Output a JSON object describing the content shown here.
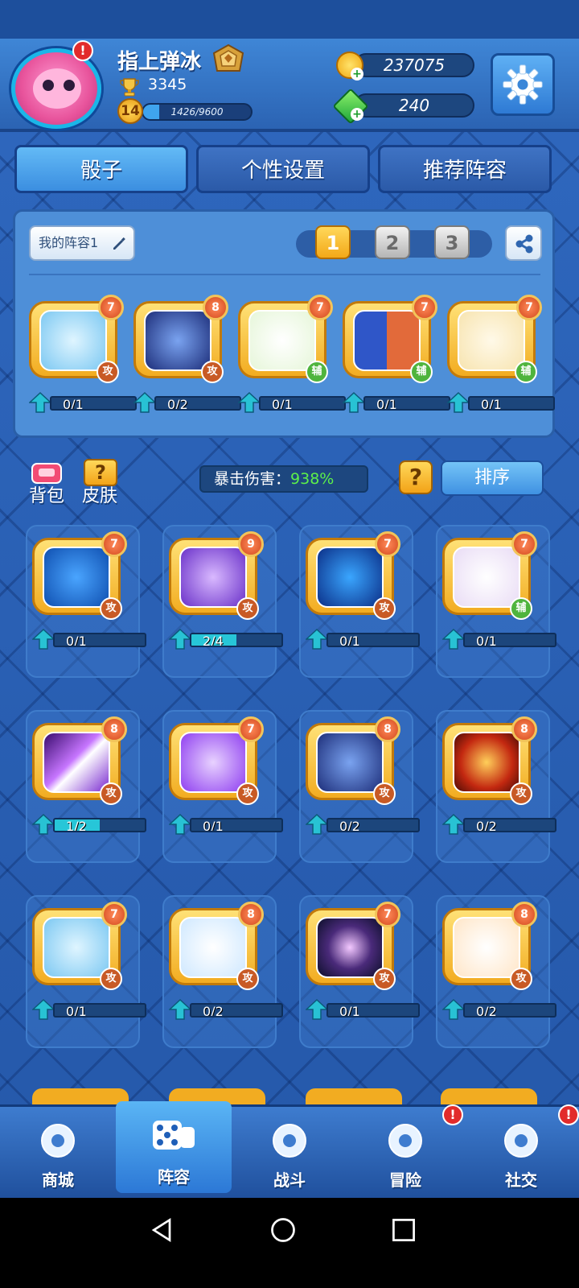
{
  "player": {
    "name": "指上弹冰",
    "trophies": "3345",
    "level": "14",
    "xp": "1426/9600",
    "xp_fraction": 0.15,
    "avatar_alert": "!"
  },
  "currency": {
    "gold": "237075",
    "gems": "240"
  },
  "tabs": [
    {
      "label": "骰子",
      "active": true
    },
    {
      "label": "个性设置",
      "active": false
    },
    {
      "label": "推荐阵容",
      "active": false
    }
  ],
  "deck": {
    "name": "我的阵容1",
    "slots": [
      "1",
      "2",
      "3"
    ],
    "active_slot": "1",
    "dice": [
      {
        "icon": "sword-icon",
        "level": "7",
        "type": "攻",
        "progress": "0/1",
        "fraction": 0
      },
      {
        "icon": "lotus-icon",
        "level": "8",
        "type": "攻",
        "progress": "0/2",
        "fraction": 0
      },
      {
        "icon": "cross-heal-icon",
        "level": "7",
        "type": "辅",
        "progress": "0/1",
        "fraction": 0
      },
      {
        "icon": "figure-icon",
        "level": "7",
        "type": "辅",
        "progress": "0/1",
        "fraction": 0
      },
      {
        "icon": "lucky-cat-icon",
        "level": "7",
        "type": "辅",
        "progress": "0/1",
        "fraction": 0
      }
    ]
  },
  "side": {
    "backpack": "背包",
    "skin": "皮肤",
    "skin_q": "?",
    "crit_label": "暴击伤害：",
    "crit_value": "938%",
    "help": "?",
    "sort": "排序"
  },
  "collection": [
    {
      "icon": "aquarius-icon",
      "level": "7",
      "type": "攻",
      "progress": "0/1",
      "fraction": 0
    },
    {
      "icon": "archer-icon",
      "level": "9",
      "type": "攻",
      "progress": "2/4",
      "fraction": 0.5
    },
    {
      "icon": "scorpion-icon",
      "level": "7",
      "type": "攻",
      "progress": "0/1",
      "fraction": 0
    },
    {
      "icon": "witch-hat-icon",
      "level": "7",
      "type": "辅",
      "progress": "0/1",
      "fraction": 0
    },
    {
      "icon": "purple-beam-icon",
      "level": "8",
      "type": "攻",
      "progress": "1/2",
      "fraction": 0.5
    },
    {
      "icon": "ghost-icon",
      "level": "7",
      "type": "攻",
      "progress": "0/1",
      "fraction": 0
    },
    {
      "icon": "lotus-icon",
      "level": "8",
      "type": "攻",
      "progress": "0/2",
      "fraction": 0
    },
    {
      "icon": "fire-icon",
      "level": "8",
      "type": "攻",
      "progress": "0/2",
      "fraction": 0
    },
    {
      "icon": "sword-icon",
      "level": "7",
      "type": "攻",
      "progress": "0/1",
      "fraction": 0
    },
    {
      "icon": "ice-sword-icon",
      "level": "8",
      "type": "攻",
      "progress": "0/2",
      "fraction": 0
    },
    {
      "icon": "galaxy-icon",
      "level": "7",
      "type": "攻",
      "progress": "0/1",
      "fraction": 0
    },
    {
      "icon": "banner-icon",
      "level": "8",
      "type": "攻",
      "progress": "0/2",
      "fraction": 0
    }
  ],
  "nav": [
    {
      "label": "商城",
      "icon": "shop-icon",
      "active": false,
      "alert": ""
    },
    {
      "label": "阵容",
      "icon": "dice-icon",
      "active": true,
      "alert": ""
    },
    {
      "label": "战斗",
      "icon": "crossed-swords-icon",
      "active": false,
      "alert": ""
    },
    {
      "label": "冒险",
      "icon": "adventure-icon",
      "active": false,
      "alert": "!"
    },
    {
      "label": "社交",
      "icon": "chat-icon",
      "active": false,
      "alert": "!"
    }
  ],
  "colors": {
    "atk": "#c85a25",
    "sup": "#4fb43d",
    "crit_value": "#5df04a"
  }
}
